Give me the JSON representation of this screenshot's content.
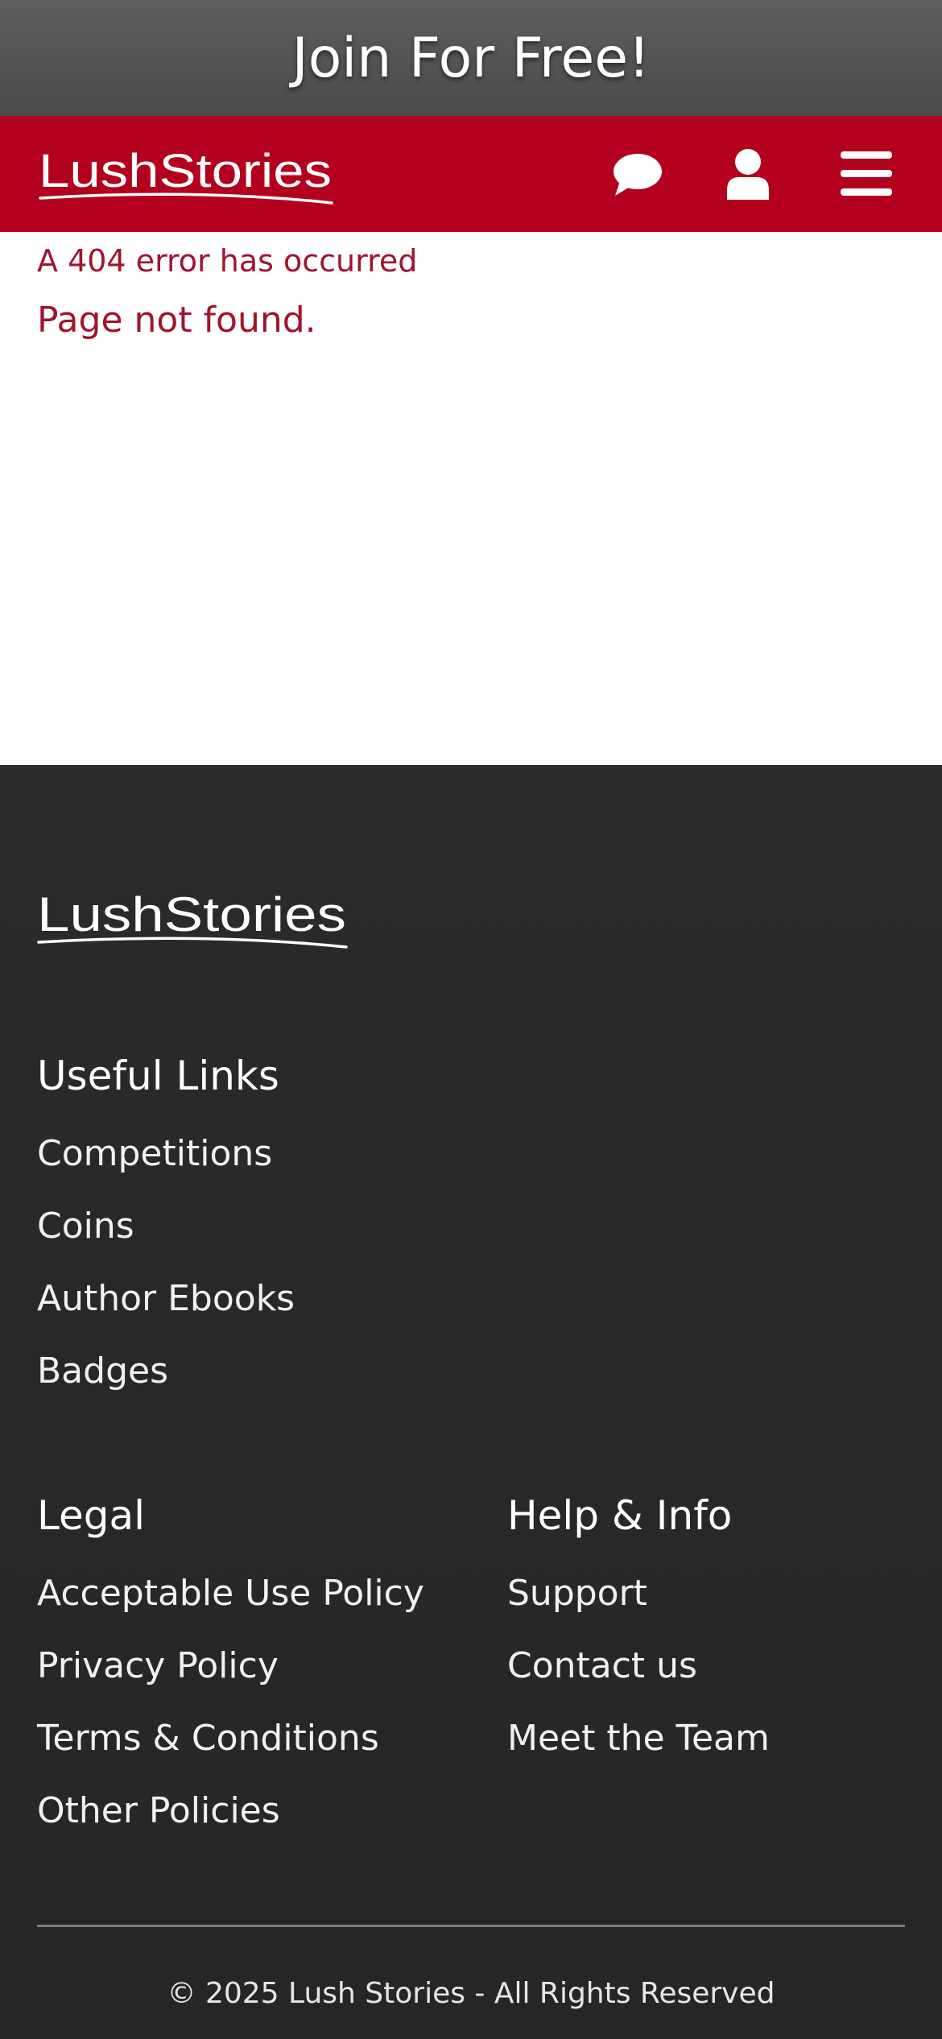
{
  "banner": {
    "join_label": "Join For Free!"
  },
  "brand": {
    "logo_text": "LushStories"
  },
  "nav": {
    "chat_icon": "chat-bubble-icon",
    "user_icon": "user-icon",
    "menu_icon": "hamburger-menu-icon"
  },
  "error": {
    "code_text": "A 404 error has occurred",
    "message": "Page not found."
  },
  "footer": {
    "useful_links": {
      "title": "Useful Links",
      "items": [
        "Competitions",
        "Coins",
        "Author Ebooks",
        "Badges"
      ]
    },
    "legal": {
      "title": "Legal",
      "items": [
        "Acceptable Use Policy",
        "Privacy Policy",
        "Terms & Conditions",
        "Other Policies"
      ]
    },
    "help": {
      "title": "Help & Info",
      "items": [
        "Support",
        "Contact us",
        "Meet the Team"
      ]
    },
    "copyright": "© 2025 Lush Stories - All Rights Reserved"
  },
  "colors": {
    "brand_red": "#b2001e",
    "error_red": "#a0152d",
    "footer_bg": "#282828",
    "banner_bg": "#575757"
  }
}
